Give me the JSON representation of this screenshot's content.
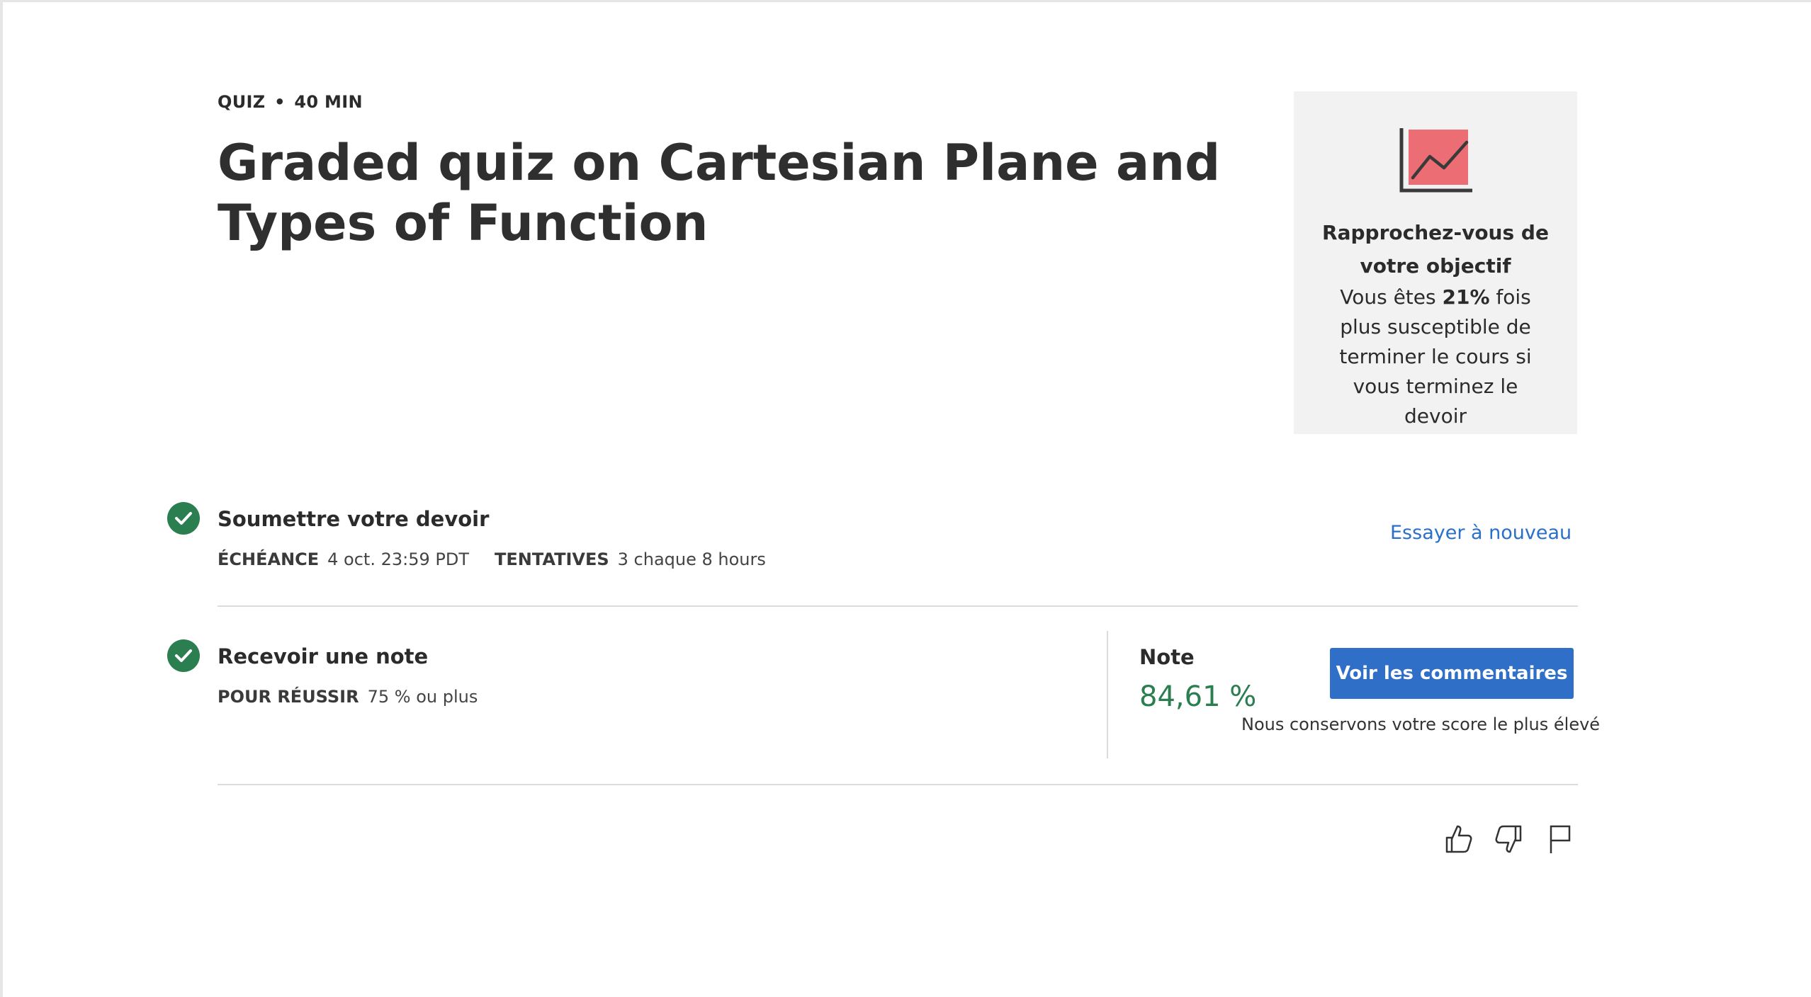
{
  "header": {
    "type_label": "QUIZ",
    "separator": "•",
    "duration": "40  MIN",
    "title": "Graded quiz on Cartesian Plane and Types of Function"
  },
  "goal_card": {
    "icon": "trending-chart-icon",
    "title": "Rapprochez-vous de votre objectif",
    "text_before": "Vous êtes ",
    "highlight": "21%",
    "text_after": " fois plus susceptible de terminer le cours si vous terminez le devoir"
  },
  "submit_step": {
    "title": "Soumettre votre devoir",
    "due_label": "ÉCHÉANCE",
    "due_value": "4 oct. 23:59 PDT",
    "attempts_label": "TENTATIVES",
    "attempts_value": "3 chaque 8  hours",
    "retry_link": "Essayer à nouveau"
  },
  "grade_step": {
    "title": "Recevoir une note",
    "pass_label": "POUR RÉUSSIR",
    "pass_value": "75 % ou plus",
    "note_label": "Note",
    "note_value": "84,61 %",
    "feedback_button": "Voir les commentaires",
    "note_sub": "Nous conservons votre score le plus élevé"
  },
  "feedback_icons": [
    "like-icon",
    "dislike-icon",
    "flag-icon"
  ],
  "colors": {
    "accent_blue": "#2f6fc8",
    "link_blue": "#2a6fc9",
    "success_green": "#2a7e4f",
    "card_bg": "#f2f2f2",
    "chart_fill": "#ec6d74"
  }
}
